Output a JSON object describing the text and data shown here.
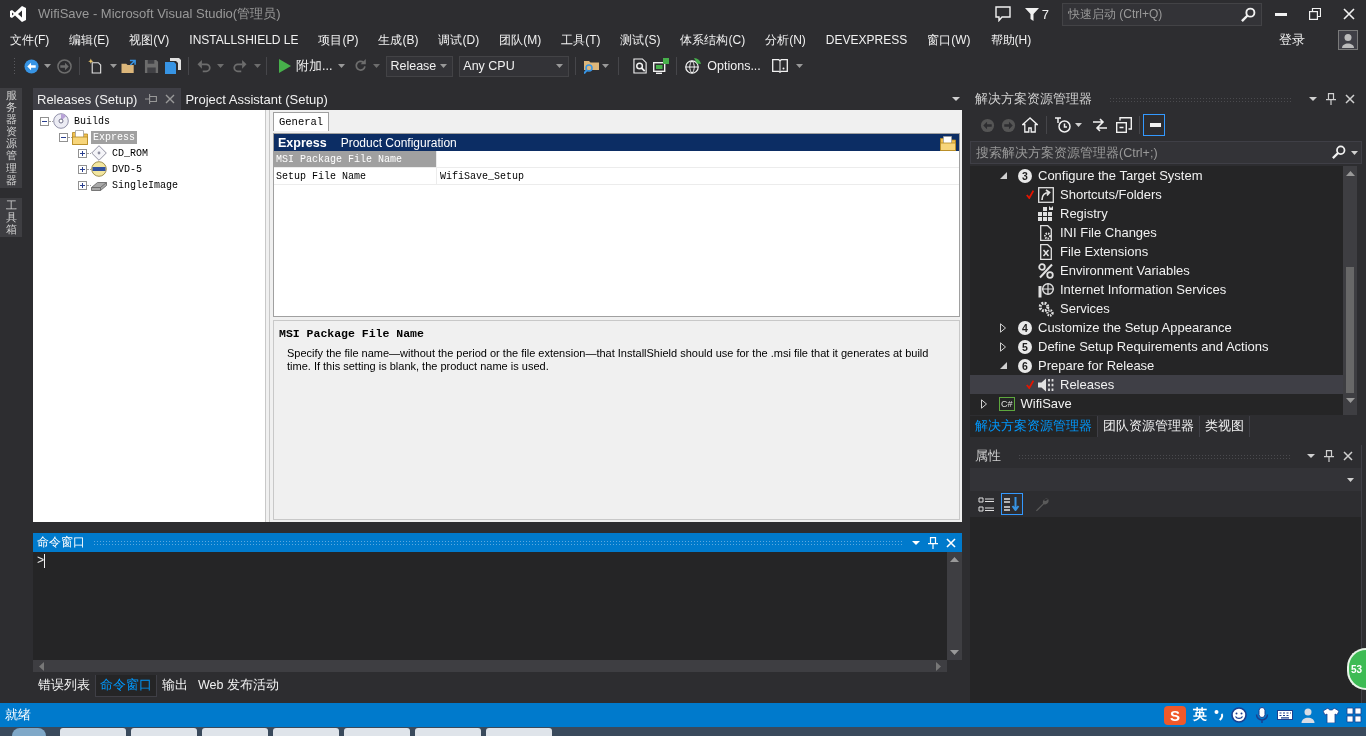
{
  "window": {
    "title": "WifiSave - Microsoft Visual Studio(管理员)",
    "notification_count": "7",
    "quick_launch": {
      "placeholder": "快速启动 (Ctrl+Q)"
    },
    "sign_in": "登录"
  },
  "menu": [
    "文件(F)",
    "编辑(E)",
    "视图(V)",
    "INSTALLSHIELD LE",
    "项目(P)",
    "生成(B)",
    "调试(D)",
    "团队(M)",
    "工具(T)",
    "测试(S)",
    "体系结构(C)",
    "分析(N)",
    "DEVEXPRESS",
    "窗口(W)",
    "帮助(H)"
  ],
  "toolbar": {
    "attach": "附加...",
    "configuration": "Release",
    "platform": "Any CPU",
    "options": "Options..."
  },
  "side_tabs": [
    "服务器资源管理器",
    "工具箱"
  ],
  "document_tabs": [
    {
      "label": "Releases (Setup)",
      "selected": true
    },
    {
      "label": "Project Assistant (Setup)",
      "selected": false
    }
  ],
  "release_tree": [
    {
      "label": "Builds",
      "expanded": true,
      "selected": false,
      "children": [
        {
          "label": "Express",
          "expanded": true,
          "selected": true,
          "children": [
            {
              "label": "CD_ROM",
              "expanded": false,
              "selected": false
            },
            {
              "label": "DVD-5",
              "expanded": false,
              "selected": false
            },
            {
              "label": "SingleImage",
              "expanded": false,
              "selected": false
            }
          ]
        }
      ]
    }
  ],
  "settings": {
    "tabs": [
      {
        "label": "General",
        "selected": true
      }
    ],
    "header": {
      "title": "Express",
      "subtitle": "Product Configuration"
    },
    "rows": [
      {
        "name": "MSI Package File Name",
        "selected": true
      },
      {
        "name": "Setup File Name",
        "value": "WifiSave_Setup",
        "selected": false
      }
    ],
    "description": {
      "title": "MSI Package File Name",
      "text": "Specify the file name—without the period or the file extension—that InstallShield should use for the .msi file that it generates at build time. If this setting is blank, the product name is used."
    }
  },
  "command_window": {
    "title": "命令窗口",
    "prompt": ">"
  },
  "output_tabs": [
    {
      "label": "错误列表",
      "selected": false
    },
    {
      "label": "命令窗口",
      "selected": true
    },
    {
      "label": "输出",
      "selected": false
    },
    {
      "label": "Web 发布活动",
      "selected": false
    }
  ],
  "solution_explorer": {
    "title": "解决方案资源管理器",
    "preview_toggle": {
      "on": true
    },
    "search": {
      "placeholder": "搜索解决方案资源管理器(Ctrl+;)"
    },
    "items": [
      {
        "children": [
          {
            "kind": "step",
            "number": "3",
            "label": "Configure the Target System",
            "expanded": true,
            "selected": false,
            "children": [
              {
                "kind": "task",
                "label": "Shortcuts/Folders",
                "checked": true,
                "selected": false
              },
              {
                "kind": "task",
                "label": "Registry",
                "checked": false,
                "selected": false
              },
              {
                "kind": "task",
                "label": "INI File Changes",
                "checked": false,
                "selected": false
              },
              {
                "kind": "task",
                "label": "File Extensions",
                "checked": false,
                "selected": false
              },
              {
                "kind": "task",
                "label": "Environment Variables",
                "checked": false,
                "selected": false
              },
              {
                "kind": "task",
                "label": "Internet Information Services",
                "checked": false,
                "selected": false
              },
              {
                "kind": "task",
                "label": "Services",
                "checked": false,
                "selected": false
              }
            ]
          },
          {
            "kind": "step",
            "number": "4",
            "label": "Customize the Setup Appearance",
            "expanded": false,
            "selected": false
          },
          {
            "kind": "step",
            "number": "5",
            "label": "Define Setup Requirements and Actions",
            "expanded": false,
            "selected": false
          },
          {
            "kind": "step",
            "number": "6",
            "label": "Prepare for Release",
            "expanded": true,
            "selected": false,
            "children": [
              {
                "kind": "task",
                "label": "Releases",
                "checked": true,
                "selected": true
              }
            ]
          }
        ]
      },
      {
        "kind": "project",
        "language": "C#",
        "label": "WifiSave",
        "expanded": false,
        "selected": false
      }
    ],
    "tabs": [
      {
        "label": "解决方案资源管理器",
        "selected": true
      },
      {
        "label": "团队资源管理器",
        "selected": false
      },
      {
        "label": "类视图",
        "selected": false
      }
    ]
  },
  "properties": {
    "title": "属性",
    "sort_buttons": [
      {
        "selected": false
      },
      {
        "selected": true
      }
    ]
  },
  "floating_badge": "53",
  "status_bar": {
    "text": "就绪",
    "ime": {
      "logo": "S",
      "mode": "英"
    }
  }
}
